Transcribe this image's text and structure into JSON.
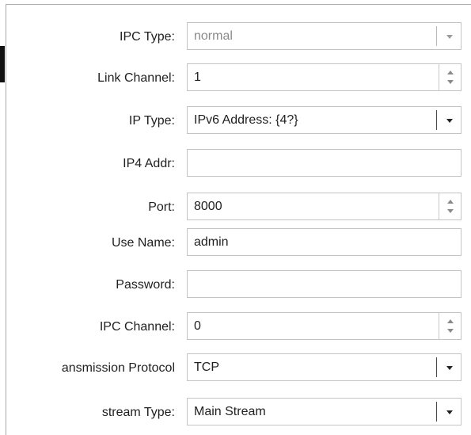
{
  "form": {
    "ipc_type": {
      "label": "IPC Type:",
      "value": "normal",
      "control": "dropdown",
      "enabled": false
    },
    "link_channel": {
      "label": "Link Channel:",
      "value": "1",
      "control": "spinner"
    },
    "ip_type": {
      "label": "IP Type:",
      "value": "IPv6 Address: {4?}",
      "control": "dropdown"
    },
    "ip4_addr": {
      "label": "IP4 Addr:",
      "value": "",
      "control": "text"
    },
    "port": {
      "label": "Port:",
      "value": "8000",
      "control": "spinner"
    },
    "user_name": {
      "label": "Use Name:",
      "value": "admin",
      "control": "text"
    },
    "password": {
      "label": "Password:",
      "value": "",
      "control": "password"
    },
    "ipc_channel": {
      "label": "IPC Channel:",
      "value": "0",
      "control": "spinner"
    },
    "transmission_protocol": {
      "label": "ansmission Protocol",
      "value": "TCP",
      "control": "dropdown"
    },
    "stream_type": {
      "label": "stream Type:",
      "value": "Main Stream",
      "control": "dropdown"
    }
  },
  "icons": {
    "dropdown": "chevron-down-icon",
    "spinner_up": "spinner-up-icon",
    "spinner_down": "spinner-down-icon"
  },
  "colors": {
    "label_text": "#1f1f1f",
    "disabled_text": "#8a8a8a",
    "field_border": "#c4c4c4"
  }
}
